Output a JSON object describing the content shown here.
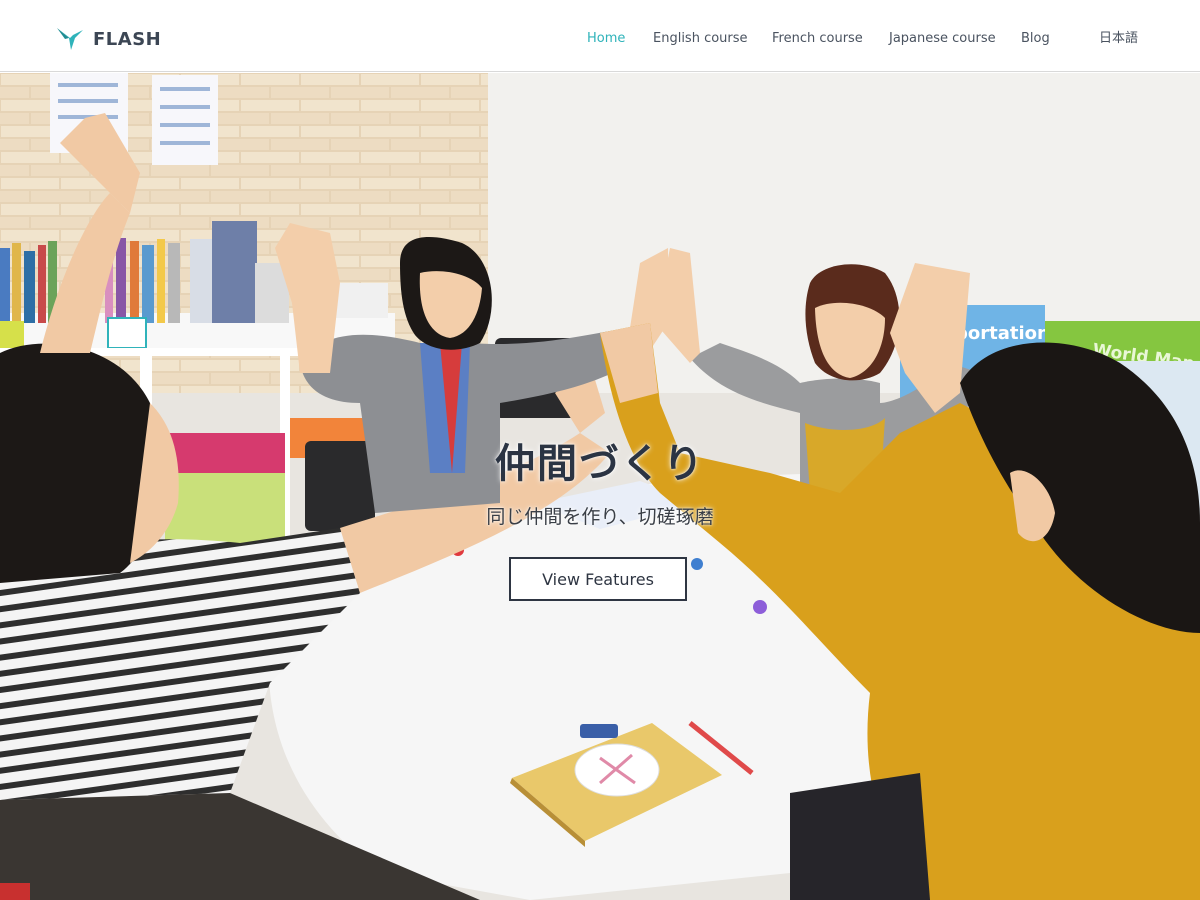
{
  "brand": {
    "name": "FLASH",
    "accent_color": "#2fb3ba",
    "logo_icon": "bird-icon"
  },
  "nav": {
    "items": [
      {
        "label": "Home",
        "active": true
      },
      {
        "label": "English course",
        "active": false
      },
      {
        "label": "French course",
        "active": false
      },
      {
        "label": "Japanese course",
        "active": false
      },
      {
        "label": "Blog",
        "active": false
      }
    ],
    "language": "日本語"
  },
  "hero": {
    "title": "仲間づくり",
    "subtitle": "同じ仲間を作り、切磋琢磨",
    "button_label": "View Features",
    "photo_sign_1": "portation",
    "photo_sign_2": "World Map"
  }
}
